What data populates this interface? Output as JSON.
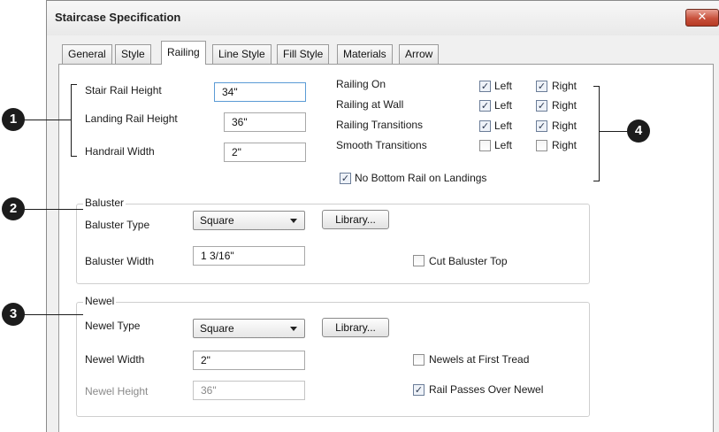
{
  "window": {
    "title": "Staircase Specification",
    "close_glyph": "✕"
  },
  "tabs": [
    {
      "label": "General"
    },
    {
      "label": "Style"
    },
    {
      "label": "Railing"
    },
    {
      "label": "Line Style"
    },
    {
      "label": "Fill Style"
    },
    {
      "label": "Materials"
    },
    {
      "label": "Arrow"
    }
  ],
  "active_tab": "Railing",
  "rail_heights": {
    "stair_rail_height_label": "Stair Rail Height",
    "stair_rail_height_value": "34\"",
    "landing_rail_height_label": "Landing Rail Height",
    "landing_rail_height_value": "36\"",
    "handrail_width_label": "Handrail Width",
    "handrail_width_value": "2\""
  },
  "railing_options": {
    "left_label": "Left",
    "right_label": "Right",
    "rows": [
      {
        "label": "Railing On",
        "left": true,
        "right": true
      },
      {
        "label": "Railing at Wall",
        "left": true,
        "right": true
      },
      {
        "label": "Railing Transitions",
        "left": true,
        "right": true
      },
      {
        "label": "Smooth Transitions",
        "left": false,
        "right": false
      }
    ],
    "no_bottom_rail_label": "No Bottom Rail on Landings",
    "no_bottom_rail_checked": true
  },
  "baluster": {
    "group_title": "Baluster",
    "type_label": "Baluster Type",
    "type_value": "Square",
    "library_label": "Library...",
    "width_label": "Baluster Width",
    "width_value": "1 3/16\"",
    "cut_top_label": "Cut Baluster Top",
    "cut_top_checked": false
  },
  "newel": {
    "group_title": "Newel",
    "type_label": "Newel Type",
    "type_value": "Square",
    "library_label": "Library...",
    "width_label": "Newel Width",
    "width_value": "2\"",
    "height_label": "Newel Height",
    "height_value": "36\"",
    "first_tread_label": "Newels at First Tread",
    "first_tread_checked": false,
    "rail_passes_label": "Rail Passes Over Newel",
    "rail_passes_checked": true
  },
  "callouts": [
    "1",
    "2",
    "3",
    "4"
  ],
  "check_glyph": "✓"
}
